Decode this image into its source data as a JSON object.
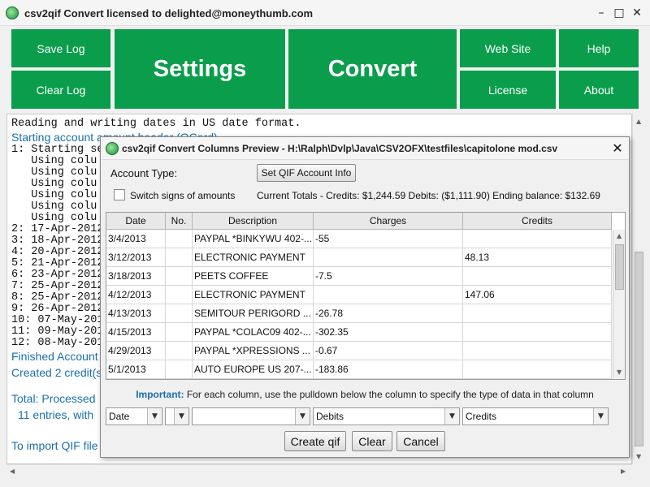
{
  "window": {
    "title": "csv2qif Convert licensed to delighted@moneythumb.com",
    "controls": {
      "minimize": "–",
      "maximize": "□",
      "close": "✕"
    }
  },
  "toolbar": {
    "save_log": "Save Log",
    "clear_log": "Clear Log",
    "settings": "Settings",
    "convert": "Convert",
    "web_site": "Web Site",
    "help": "Help",
    "license": "License",
    "about": "About"
  },
  "log": {
    "lines": [
      {
        "text": "Reading and writing dates in US date format.",
        "style": "mono"
      },
      {
        "text": "Starting account amount header (OCard)",
        "style": "blue"
      },
      {
        "text": "1: Starting se",
        "style": "mono"
      },
      {
        "text": "   Using colu",
        "style": "mono"
      },
      {
        "text": "   Using colu",
        "style": "mono"
      },
      {
        "text": "   Using colu",
        "style": "mono"
      },
      {
        "text": "   Using colu",
        "style": "mono"
      },
      {
        "text": "   Using colu",
        "style": "mono"
      },
      {
        "text": "   Using colu",
        "style": "mono"
      },
      {
        "text": "2: 17-Apr-2012",
        "style": "mono"
      },
      {
        "text": "3: 18-Apr-2012",
        "style": "mono"
      },
      {
        "text": "4: 20-Apr-2012",
        "style": "mono"
      },
      {
        "text": "5: 21-Apr-2012",
        "style": "mono"
      },
      {
        "text": "6: 23-Apr-2012",
        "style": "mono"
      },
      {
        "text": "7: 25-Apr-2012",
        "style": "mono"
      },
      {
        "text": "8: 25-Apr-2012",
        "style": "mono"
      },
      {
        "text": "9: 26-Apr-2012",
        "style": "mono"
      },
      {
        "text": "10: 07-May-201",
        "style": "mono"
      },
      {
        "text": "11: 09-May-201",
        "style": "mono"
      },
      {
        "text": "12: 08-May-201",
        "style": "mono"
      },
      {
        "text": "Finished Account",
        "style": "blue"
      },
      {
        "text": "Created 2 credit(s",
        "style": "blue"
      },
      {
        "text": "Total: Processed",
        "style": "blue"
      },
      {
        "text": "11 entries, with",
        "style": "blue"
      },
      {
        "text": "To import QIF file",
        "style": "blue"
      }
    ]
  },
  "dialog": {
    "title": "csv2qif Convert Columns Preview - H:\\Ralph\\Dvlp\\Java\\CSV2OFX\\testfiles\\capitolone mod.csv",
    "close": "✕",
    "account_type_label": "Account Type:",
    "set_qif_button": "Set QIF Account Info",
    "switch_signs_label": "Switch signs of amounts",
    "totals": "Current Totals - Credits: $1,244.59  Debits: ($1,111.90)   Ending balance: $132.69",
    "table": {
      "headers": [
        "Date",
        "No.",
        "Description",
        "Charges",
        "Credits"
      ],
      "rows": [
        [
          "3/4/2013",
          "",
          "PAYPAL *BINKYWU 402-...",
          "-55",
          ""
        ],
        [
          "3/12/2013",
          "",
          "ELECTRONIC PAYMENT",
          "",
          "48.13"
        ],
        [
          "3/18/2013",
          "",
          "PEETS COFFEE",
          "-7.5",
          ""
        ],
        [
          "4/12/2013",
          "",
          "ELECTRONIC PAYMENT",
          "",
          "147.06"
        ],
        [
          "4/13/2013",
          "",
          "SEMITOUR PERIGORD ...",
          "-26.78",
          ""
        ],
        [
          "4/15/2013",
          "",
          "PAYPAL *COLAC09 402-...",
          "-302.35",
          ""
        ],
        [
          "4/29/2013",
          "",
          "PAYPAL *XPRESSIONS ...",
          "-0.67",
          ""
        ],
        [
          "5/1/2013",
          "",
          "AUTO EUROPE US 207-...",
          "-183.86",
          ""
        ]
      ]
    },
    "important_label": "Important:",
    "important_text": " For each column, use the pulldown below the column to specify the type of data in that column",
    "column_types": [
      "Date",
      "",
      "",
      "Debits",
      "Credits"
    ],
    "create_qif_button": "Create qif",
    "clear_button": "Clear",
    "cancel_button": "Cancel"
  },
  "colors": {
    "accent_green": "#0a9e4c",
    "log_blue": "#1a6fb0"
  }
}
